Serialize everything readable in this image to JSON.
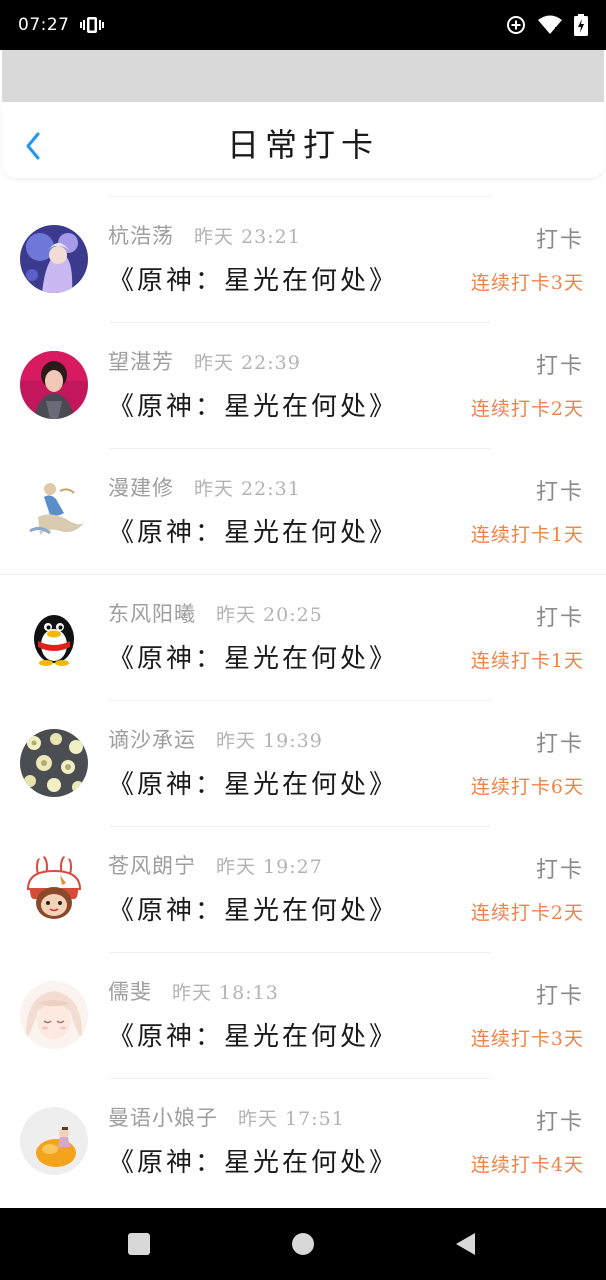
{
  "status_bar": {
    "time": "07:27",
    "icons": [
      "vibrate-icon",
      "data-saver-icon",
      "wifi-icon",
      "battery-icon"
    ]
  },
  "header": {
    "back_icon": "chevron-left-icon",
    "title": "日常打卡",
    "accent_color": "#2196f3"
  },
  "colors": {
    "streak": "#f0834a",
    "name": "#9e9e9e",
    "title": "#1a1a1a"
  },
  "rows": [
    {
      "name": "杭浩荡",
      "time": "昨天 23:21",
      "title": "《原神：星光在何处》",
      "action": "打卡",
      "streak": "连续打卡3天",
      "avatar": "anime-girl-purple-avatar"
    },
    {
      "name": "望湛芳",
      "time": "昨天 22:39",
      "title": "《原神：星光在何处》",
      "action": "打卡",
      "streak": "连续打卡2天",
      "avatar": "woman-portrait-avatar"
    },
    {
      "name": "漫建修",
      "time": "昨天 22:31",
      "title": "《原神：星光在何处》",
      "action": "打卡",
      "streak": "连续打卡1天",
      "avatar": "dancer-figure-avatar"
    },
    {
      "name": "东风阳曦",
      "time": "昨天 20:25",
      "title": "《原神：星光在何处》",
      "action": "打卡",
      "streak": "连续打卡1天",
      "avatar": "penguin-avatar"
    },
    {
      "name": "谪沙承运",
      "time": "昨天 19:39",
      "title": "《原神：星光在何处》",
      "action": "打卡",
      "streak": "连续打卡6天",
      "avatar": "floral-pattern-avatar"
    },
    {
      "name": "苍风朗宁",
      "time": "昨天 19:27",
      "title": "《原神：星光在何处》",
      "action": "打卡",
      "streak": "连续打卡2天",
      "avatar": "bunny-cartoon-avatar"
    },
    {
      "name": "儒斐",
      "time": "昨天 18:13",
      "title": "《原神：星光在何处》",
      "action": "打卡",
      "streak": "连续打卡3天",
      "avatar": "sleepy-anime-girl-avatar"
    },
    {
      "name": "曼语小娘子",
      "time": "昨天 17:51",
      "title": "《原神：星光在何处》",
      "action": "打卡",
      "streak": "连续打卡4天",
      "avatar": "orange-fruit-avatar"
    }
  ],
  "nav": {
    "items": [
      "recents-square-icon",
      "home-circle-icon",
      "back-triangle-icon"
    ]
  }
}
